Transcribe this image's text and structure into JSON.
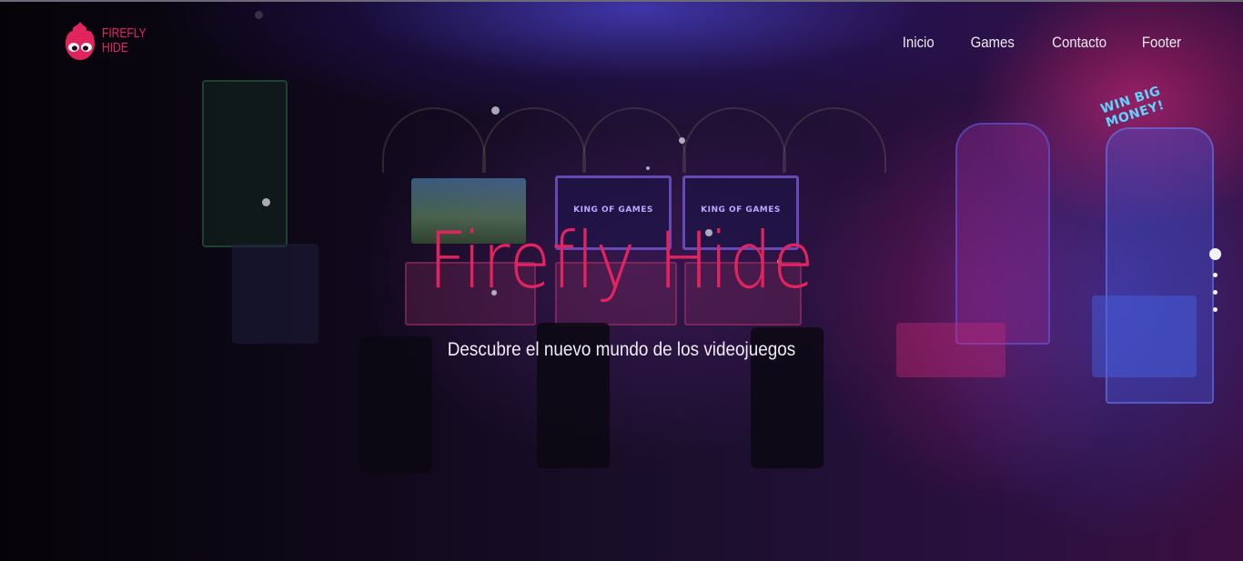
{
  "brand": {
    "line1": "FIREFLY",
    "line2": "HIDE",
    "accent_color": "#e0245e"
  },
  "nav": {
    "items": [
      "Inicio",
      "Games",
      "Contacto",
      "Footer"
    ]
  },
  "hero": {
    "title": "Firefly Hide",
    "subtitle": "Descubre el nuevo mundo de los videojuegos",
    "background": "arcade-room-photo",
    "scene_texts": {
      "screen_left": "KING OF GAMES",
      "screen_right": "KING OF GAMES",
      "neon_sign": "WIN BIG MONEY!"
    }
  },
  "slider": {
    "slides": 4,
    "active": 1
  }
}
